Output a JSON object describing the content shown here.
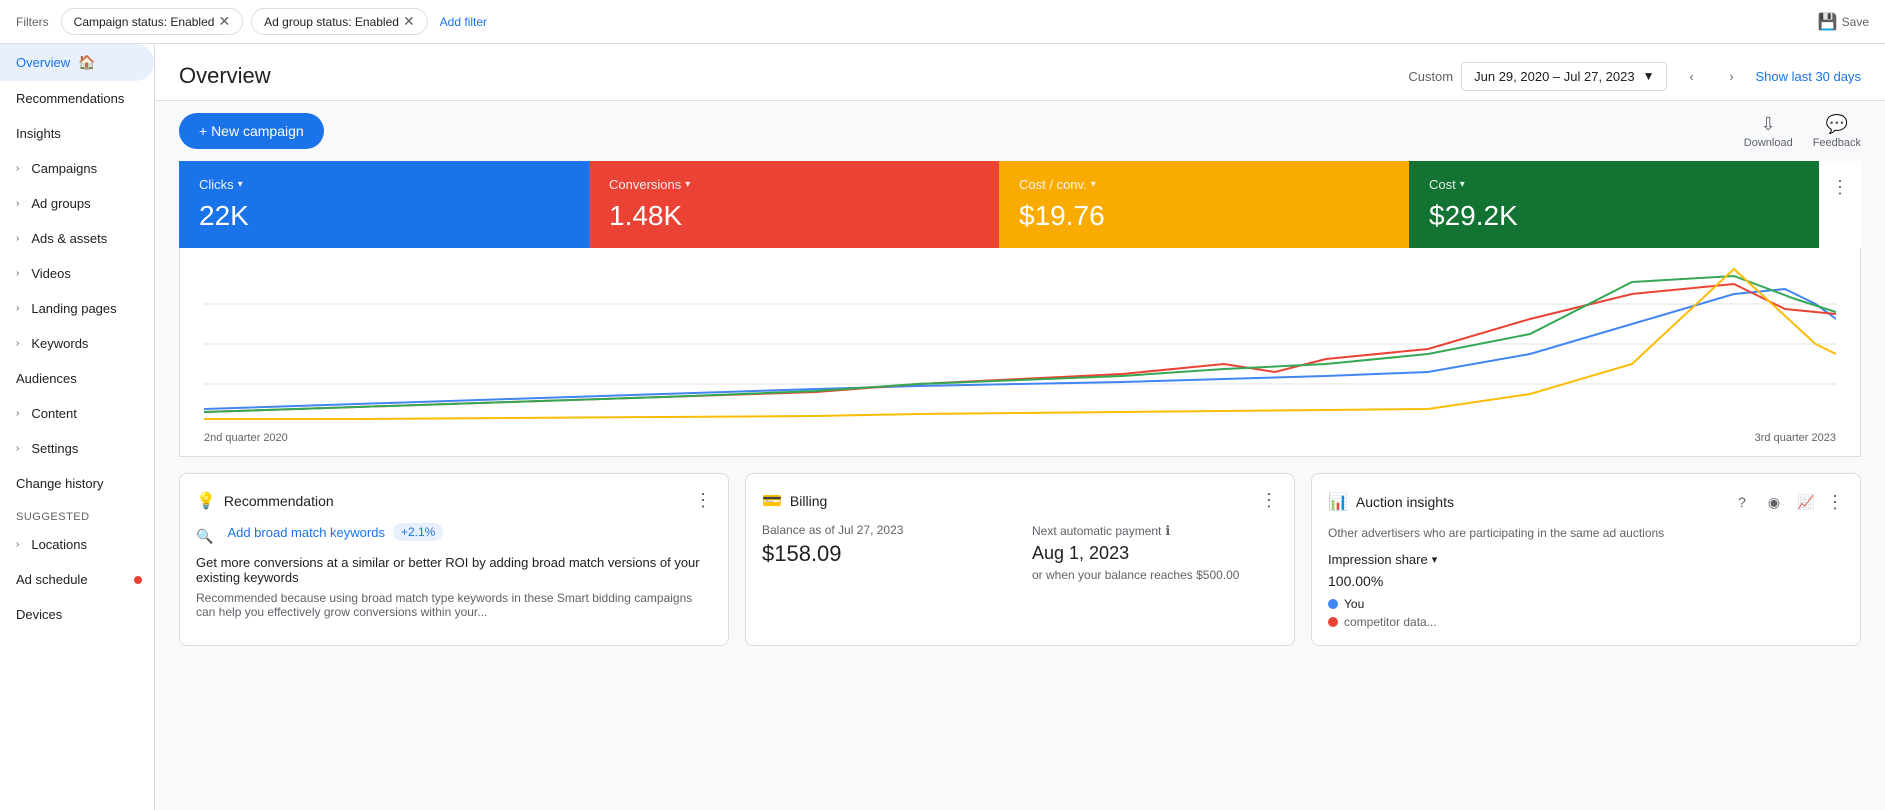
{
  "filters": {
    "label": "Filters",
    "chips": [
      {
        "id": "campaign-status",
        "label": "Campaign status: Enabled"
      },
      {
        "id": "ad-group-status",
        "label": "Ad group status: Enabled"
      }
    ],
    "add_filter": "Add filter",
    "save_label": "Save"
  },
  "sidebar": {
    "items": [
      {
        "id": "overview",
        "label": "Overview",
        "active": true,
        "hasHome": true,
        "hasChevron": false
      },
      {
        "id": "recommendations",
        "label": "Recommendations",
        "active": false,
        "hasChevron": false
      },
      {
        "id": "insights",
        "label": "Insights",
        "active": false,
        "hasChevron": false
      },
      {
        "id": "campaigns",
        "label": "Campaigns",
        "active": false,
        "hasChevron": true
      },
      {
        "id": "ad-groups",
        "label": "Ad groups",
        "active": false,
        "hasChevron": true
      },
      {
        "id": "ads-assets",
        "label": "Ads & assets",
        "active": false,
        "hasChevron": true
      },
      {
        "id": "videos",
        "label": "Videos",
        "active": false,
        "hasChevron": true
      },
      {
        "id": "landing-pages",
        "label": "Landing pages",
        "active": false,
        "hasChevron": true
      },
      {
        "id": "keywords",
        "label": "Keywords",
        "active": false,
        "hasChevron": true
      },
      {
        "id": "audiences",
        "label": "Audiences",
        "active": false,
        "hasChevron": false
      },
      {
        "id": "content",
        "label": "Content",
        "active": false,
        "hasChevron": true
      },
      {
        "id": "settings",
        "label": "Settings",
        "active": false,
        "hasChevron": true
      },
      {
        "id": "change-history",
        "label": "Change history",
        "active": false,
        "hasChevron": false
      }
    ],
    "section_suggested": "Suggested",
    "suggested_items": [
      {
        "id": "locations",
        "label": "Locations",
        "hasChevron": true
      },
      {
        "id": "ad-schedule",
        "label": "Ad schedule",
        "hasDot": true
      },
      {
        "id": "devices",
        "label": "Devices",
        "hasChevron": false
      }
    ]
  },
  "overview": {
    "title": "Overview",
    "date": {
      "custom_label": "Custom",
      "range": "Jun 29, 2020 – Jul 27, 2023",
      "show_last": "Show last 30 days"
    },
    "new_campaign_label": "+ New campaign",
    "download_label": "Download",
    "feedback_label": "Feedback",
    "metric_cards": [
      {
        "id": "clicks",
        "label": "Clicks",
        "value": "22K",
        "color": "blue"
      },
      {
        "id": "conversions",
        "label": "Conversions",
        "value": "1.48K",
        "color": "red"
      },
      {
        "id": "cost-conv",
        "label": "Cost / conv.",
        "value": "$19.76",
        "color": "orange"
      },
      {
        "id": "cost",
        "label": "Cost",
        "value": "$29.2K",
        "color": "green"
      }
    ],
    "chart": {
      "x_start": "2nd quarter 2020",
      "x_end": "3rd quarter 2023"
    }
  },
  "bottom_cards": {
    "recommendation": {
      "title": "Recommendation",
      "chip": "+2.1%",
      "link": "Add broad match keywords",
      "desc": "Get more conversions at a similar or better ROI by adding broad match versions of your existing keywords",
      "sub": "Recommended because using broad match type keywords in these Smart bidding campaigns can help you effectively grow conversions within your..."
    },
    "billing": {
      "title": "Billing",
      "balance_label": "Balance as of Jul 27, 2023",
      "balance_value": "$158.09",
      "next_payment_label": "Next automatic payment",
      "next_payment_value": "Aug 1, 2023",
      "next_payment_sub": "or when your balance reaches $500.00"
    },
    "auction": {
      "title": "Auction insights",
      "desc": "Other advertisers who are participating in the same ad auctions",
      "impression_share_label": "Impression share",
      "impression_value": "100.00%",
      "legend": [
        {
          "label": "You",
          "color": "#4285f4"
        },
        {
          "label": "competitor",
          "color": "#ea4335"
        }
      ]
    }
  }
}
